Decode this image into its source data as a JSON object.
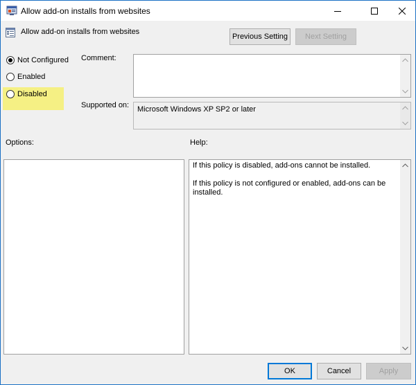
{
  "window": {
    "title": "Allow add-on installs from websites",
    "controls": {
      "minimize": "minimize-icon",
      "maximize": "maximize-icon",
      "close": "close-icon"
    }
  },
  "header": {
    "title": "Allow add-on installs from websites",
    "icon": "policy-setting-icon"
  },
  "nav": {
    "previous_label": "Previous Setting",
    "next_label": "Next Setting"
  },
  "state": {
    "options": [
      {
        "label": "Not Configured",
        "checked": true
      },
      {
        "label": "Enabled",
        "checked": false
      },
      {
        "label": "Disabled",
        "checked": false
      }
    ],
    "highlight_color": "#f5f084"
  },
  "comment": {
    "label": "Comment:",
    "value": ""
  },
  "supported": {
    "label": "Supported on:",
    "value": "Microsoft Windows XP SP2 or later"
  },
  "options_panel": {
    "label": "Options:"
  },
  "help_panel": {
    "label": "Help:",
    "paragraphs": [
      "If this policy is disabled, add-ons cannot be installed.",
      "If this policy is not configured or enabled, add-ons can be installed."
    ]
  },
  "footer": {
    "ok_label": "OK",
    "cancel_label": "Cancel",
    "apply_label": "Apply"
  },
  "colors": {
    "accent": "#0078d7",
    "window_border": "#1a70c4",
    "dialog_bg": "#f0f0f0"
  }
}
